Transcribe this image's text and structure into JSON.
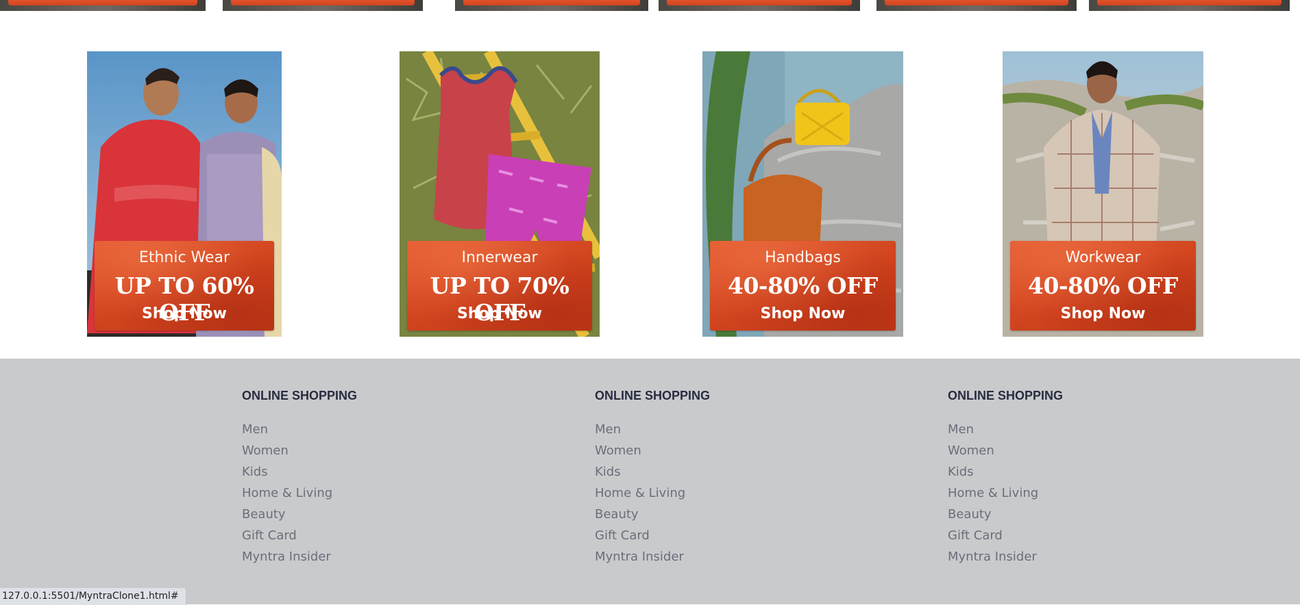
{
  "offers": [
    {
      "category": "Ethnic Wear",
      "deal": "UP TO 60% OFF",
      "cta": "Shop Now"
    },
    {
      "category": "Innerwear",
      "deal": "UP TO 70% OFF",
      "cta": "Shop Now"
    },
    {
      "category": "Handbags",
      "deal": "40-80% OFF",
      "cta": "Shop Now"
    },
    {
      "category": "Workwear",
      "deal": "40-80% OFF",
      "cta": "Shop Now"
    }
  ],
  "footer": {
    "columns": [
      {
        "heading": "ONLINE SHOPPING",
        "links": [
          "Men",
          "Women",
          "Kids",
          "Home & Living",
          "Beauty",
          "Gift Card",
          "Myntra Insider"
        ]
      },
      {
        "heading": "ONLINE SHOPPING",
        "links": [
          "Men",
          "Women",
          "Kids",
          "Home & Living",
          "Beauty",
          "Gift Card",
          "Myntra Insider"
        ]
      },
      {
        "heading": "ONLINE SHOPPING",
        "links": [
          "Men",
          "Women",
          "Kids",
          "Home & Living",
          "Beauty",
          "Gift Card",
          "Myntra Insider"
        ]
      }
    ]
  },
  "status_bar": {
    "url": "127.0.0.1:5501/MyntraClone1.html#"
  },
  "colors": {
    "offer_band": "#d84a24",
    "footer_bg": "#c9cacc",
    "footer_heading": "#282c3f",
    "footer_link": "#696e79"
  }
}
